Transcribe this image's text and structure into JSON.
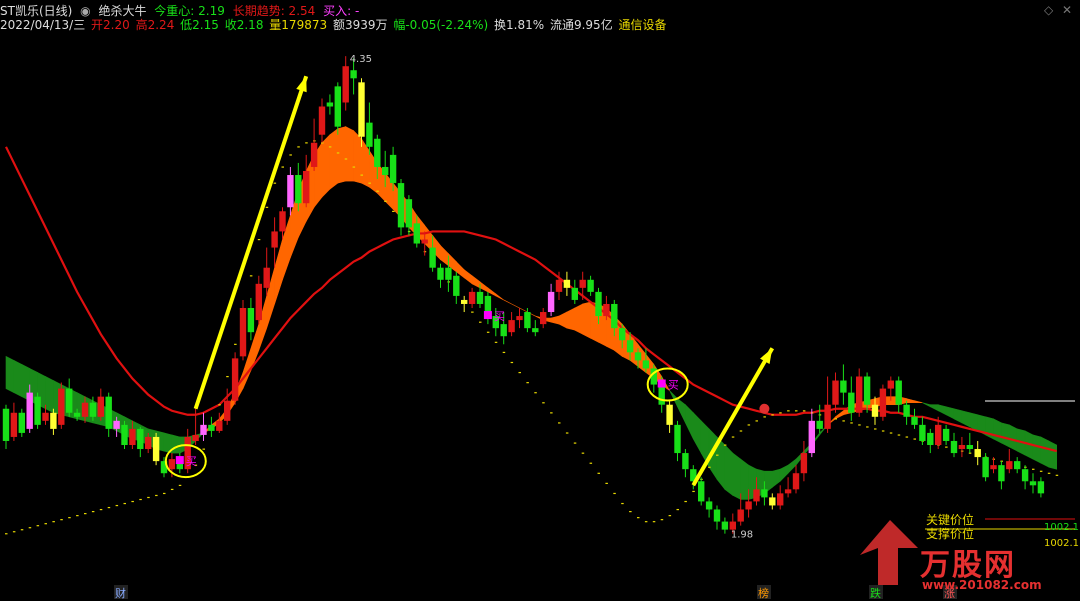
{
  "header": {
    "stock": "ST凯乐(日线)",
    "indicator": "绝杀大牛",
    "center_label": "今重心: 2.19",
    "trend_label": "长期趋势: 2.54",
    "signal_label": "买入: -"
  },
  "quote": {
    "date": "2022/04/13/三",
    "open": "开2.20",
    "high": "高2.24",
    "low": "低2.15",
    "close": "收2.18",
    "volume": "量179873",
    "amount": "额3939万",
    "change": "幅-0.05(-2.24%)",
    "turnover": "换1.81%",
    "float_value": "流通9.95亿",
    "sector": "通信设备"
  },
  "colors": {
    "up": "#e01818",
    "down": "#18e018",
    "ribbon_up": "#ff6600",
    "ribbon_down": "#1a8a1a",
    "trend_line": "#e01010",
    "support_dots": "#e8d800",
    "arrow": "#ffff00",
    "buy_marker": "#ff00ff"
  },
  "chart_data": {
    "type": "candlestick",
    "ylim": [
      1.75,
      4.45
    ],
    "price_high_label": "4.35",
    "price_low_label": "1.98",
    "key_level_label": "关键价位",
    "support_level_label": "支撑价位",
    "key_level_value": "1002.1",
    "support_level_value": "1002.1",
    "buy_label": "买",
    "event_tags": [
      "财",
      "榜",
      "跌",
      "涨"
    ],
    "candles": [
      [
        2.6,
        2.44,
        2.62,
        2.4
      ],
      [
        2.46,
        2.58,
        2.63,
        2.44
      ],
      [
        2.58,
        2.48,
        2.6,
        2.46
      ],
      [
        2.5,
        2.68,
        2.72,
        2.48
      ],
      [
        2.66,
        2.52,
        2.68,
        2.5
      ],
      [
        2.54,
        2.58,
        2.62,
        2.52
      ],
      [
        2.58,
        2.5,
        2.6,
        2.47
      ],
      [
        2.52,
        2.7,
        2.73,
        2.5
      ],
      [
        2.7,
        2.58,
        2.75,
        2.56
      ],
      [
        2.58,
        2.56,
        2.6,
        2.54
      ],
      [
        2.56,
        2.63,
        2.66,
        2.53
      ],
      [
        2.63,
        2.56,
        2.66,
        2.54
      ],
      [
        2.56,
        2.66,
        2.7,
        2.54
      ],
      [
        2.66,
        2.5,
        2.68,
        2.46
      ],
      [
        2.5,
        2.54,
        2.56,
        2.46
      ],
      [
        2.52,
        2.42,
        2.54,
        2.4
      ],
      [
        2.42,
        2.5,
        2.54,
        2.4
      ],
      [
        2.5,
        2.4,
        2.51,
        2.36
      ],
      [
        2.4,
        2.46,
        2.48,
        2.38
      ],
      [
        2.46,
        2.34,
        2.48,
        2.32
      ],
      [
        2.34,
        2.28,
        2.36,
        2.26
      ],
      [
        2.3,
        2.35,
        2.38,
        2.26
      ],
      [
        2.35,
        2.3,
        2.38,
        2.28
      ],
      [
        2.3,
        2.46,
        2.5,
        2.28
      ],
      [
        2.44,
        2.47,
        2.62,
        2.42
      ],
      [
        2.47,
        2.52,
        2.58,
        2.44
      ],
      [
        2.52,
        2.49,
        2.56,
        2.46
      ],
      [
        2.49,
        2.54,
        2.58,
        2.48
      ],
      [
        2.54,
        2.64,
        2.7,
        2.52
      ],
      [
        2.64,
        2.85,
        2.88,
        2.62
      ],
      [
        2.86,
        3.1,
        3.14,
        2.84
      ],
      [
        3.1,
        2.98,
        3.15,
        2.94
      ],
      [
        3.04,
        3.22,
        3.26,
        3.02
      ],
      [
        3.2,
        3.3,
        3.4,
        3.16
      ],
      [
        3.4,
        3.48,
        3.55,
        3.3
      ],
      [
        3.48,
        3.58,
        3.6,
        3.44
      ],
      [
        3.6,
        3.76,
        3.8,
        3.56
      ],
      [
        3.76,
        3.62,
        3.82,
        3.58
      ],
      [
        3.62,
        3.78,
        3.86,
        3.6
      ],
      [
        3.8,
        3.92,
        4.04,
        3.78
      ],
      [
        3.96,
        4.1,
        4.14,
        3.92
      ],
      [
        4.12,
        4.1,
        4.16,
        4.06
      ],
      [
        4.2,
        4.0,
        4.22,
        3.96
      ],
      [
        4.12,
        4.3,
        4.35,
        4.08
      ],
      [
        4.28,
        4.24,
        4.34,
        4.16
      ],
      [
        4.22,
        3.95,
        4.24,
        3.9
      ],
      [
        4.02,
        3.9,
        4.12,
        3.86
      ],
      [
        3.94,
        3.8,
        3.96,
        3.74
      ],
      [
        3.8,
        3.76,
        3.88,
        3.7
      ],
      [
        3.86,
        3.72,
        3.9,
        3.68
      ],
      [
        3.72,
        3.5,
        3.74,
        3.46
      ],
      [
        3.64,
        3.5,
        3.66,
        3.46
      ],
      [
        3.52,
        3.42,
        3.56,
        3.4
      ],
      [
        3.42,
        3.44,
        3.48,
        3.36
      ],
      [
        3.4,
        3.3,
        3.46,
        3.28
      ],
      [
        3.3,
        3.24,
        3.32,
        3.2
      ],
      [
        3.3,
        3.24,
        3.36,
        3.18
      ],
      [
        3.26,
        3.16,
        3.28,
        3.12
      ],
      [
        3.14,
        3.12,
        3.16,
        3.08
      ],
      [
        3.12,
        3.18,
        3.2,
        3.1
      ],
      [
        3.18,
        3.12,
        3.22,
        3.1
      ],
      [
        3.16,
        3.06,
        3.18,
        3.02
      ],
      [
        3.06,
        3.0,
        3.1,
        2.96
      ],
      [
        3.02,
        2.96,
        3.08,
        2.92
      ],
      [
        2.98,
        3.04,
        3.08,
        2.96
      ],
      [
        3.04,
        3.06,
        3.1,
        3.0
      ],
      [
        3.08,
        3.0,
        3.1,
        2.98
      ],
      [
        3.0,
        2.98,
        3.04,
        2.96
      ],
      [
        3.02,
        3.08,
        3.1,
        3.0
      ],
      [
        3.08,
        3.18,
        3.22,
        3.06
      ],
      [
        3.18,
        3.24,
        3.28,
        3.14
      ],
      [
        3.24,
        3.2,
        3.28,
        3.16
      ],
      [
        3.2,
        3.14,
        3.24,
        3.12
      ],
      [
        3.2,
        3.24,
        3.28,
        3.14
      ],
      [
        3.24,
        3.18,
        3.26,
        3.16
      ],
      [
        3.18,
        3.06,
        3.2,
        3.02
      ],
      [
        3.06,
        3.12,
        3.16,
        3.04
      ],
      [
        3.12,
        3.0,
        3.14,
        2.96
      ],
      [
        3.0,
        2.94,
        3.02,
        2.9
      ],
      [
        2.94,
        2.88,
        2.98,
        2.84
      ],
      [
        2.88,
        2.84,
        2.9,
        2.8
      ],
      [
        2.84,
        2.8,
        2.9,
        2.78
      ],
      [
        2.8,
        2.72,
        2.82,
        2.68
      ],
      [
        2.72,
        2.62,
        2.76,
        2.58
      ],
      [
        2.62,
        2.52,
        2.64,
        2.48
      ],
      [
        2.52,
        2.38,
        2.54,
        2.34
      ],
      [
        2.38,
        2.3,
        2.4,
        2.26
      ],
      [
        2.3,
        2.24,
        2.32,
        2.2
      ],
      [
        2.24,
        2.14,
        2.26,
        2.12
      ],
      [
        2.14,
        2.1,
        2.16,
        2.06
      ],
      [
        2.1,
        2.04,
        2.12,
        2.0
      ],
      [
        2.04,
        2.0,
        2.06,
        1.98
      ],
      [
        2.0,
        2.04,
        2.08,
        1.98
      ],
      [
        2.04,
        2.1,
        2.18,
        2.02
      ],
      [
        2.1,
        2.14,
        2.2,
        2.06
      ],
      [
        2.14,
        2.2,
        2.26,
        2.12
      ],
      [
        2.2,
        2.16,
        2.24,
        2.12
      ],
      [
        2.16,
        2.12,
        2.18,
        2.1
      ],
      [
        2.12,
        2.18,
        2.22,
        2.1
      ],
      [
        2.18,
        2.2,
        2.26,
        2.16
      ],
      [
        2.2,
        2.28,
        2.32,
        2.18
      ],
      [
        2.28,
        2.38,
        2.44,
        2.24
      ],
      [
        2.38,
        2.54,
        2.6,
        2.36
      ],
      [
        2.54,
        2.5,
        2.62,
        2.48
      ],
      [
        2.5,
        2.62,
        2.76,
        2.48
      ],
      [
        2.62,
        2.74,
        2.78,
        2.58
      ],
      [
        2.74,
        2.68,
        2.82,
        2.62
      ],
      [
        2.68,
        2.58,
        2.76,
        2.54
      ],
      [
        2.58,
        2.76,
        2.8,
        2.56
      ],
      [
        2.76,
        2.62,
        2.78,
        2.58
      ],
      [
        2.62,
        2.56,
        2.66,
        2.52
      ],
      [
        2.56,
        2.7,
        2.72,
        2.54
      ],
      [
        2.7,
        2.74,
        2.76,
        2.64
      ],
      [
        2.74,
        2.62,
        2.76,
        2.58
      ],
      [
        2.62,
        2.56,
        2.64,
        2.52
      ],
      [
        2.56,
        2.52,
        2.6,
        2.5
      ],
      [
        2.52,
        2.44,
        2.56,
        2.42
      ],
      [
        2.48,
        2.42,
        2.5,
        2.38
      ],
      [
        2.42,
        2.52,
        2.56,
        2.4
      ],
      [
        2.5,
        2.44,
        2.52,
        2.42
      ],
      [
        2.44,
        2.38,
        2.48,
        2.36
      ],
      [
        2.4,
        2.42,
        2.46,
        2.36
      ],
      [
        2.42,
        2.4,
        2.48,
        2.38
      ],
      [
        2.4,
        2.36,
        2.44,
        2.32
      ],
      [
        2.36,
        2.26,
        2.38,
        2.24
      ],
      [
        2.3,
        2.32,
        2.36,
        2.28
      ],
      [
        2.32,
        2.24,
        2.34,
        2.2
      ],
      [
        2.3,
        2.34,
        2.4,
        2.28
      ],
      [
        2.34,
        2.3,
        2.36,
        2.28
      ],
      [
        2.3,
        2.24,
        2.32,
        2.2
      ],
      [
        2.24,
        2.22,
        2.28,
        2.18
      ],
      [
        2.24,
        2.18,
        2.26,
        2.16
      ]
    ],
    "ribbon_fast": [
      2.7,
      2.68,
      2.66,
      2.64,
      2.62,
      2.6,
      2.58,
      2.57,
      2.56,
      2.55,
      2.54,
      2.53,
      2.52,
      2.51,
      2.49,
      2.47,
      2.45,
      2.44,
      2.42,
      2.4,
      2.39,
      2.38,
      2.38,
      2.4,
      2.44,
      2.48,
      2.52,
      2.55,
      2.6,
      2.68,
      2.78,
      2.9,
      3.02,
      3.16,
      3.3,
      3.44,
      3.56,
      3.68,
      3.78,
      3.86,
      3.92,
      3.96,
      3.99,
      4.0,
      3.98,
      3.94,
      3.88,
      3.82,
      3.77,
      3.72,
      3.67,
      3.62,
      3.56,
      3.51,
      3.46,
      3.41,
      3.37,
      3.33,
      3.29,
      3.26,
      3.23,
      3.2,
      3.17,
      3.14,
      3.12,
      3.1,
      3.08,
      3.06,
      3.05,
      3.05,
      3.06,
      3.08,
      3.1,
      3.12,
      3.13,
      3.12,
      3.1,
      3.06,
      3.02,
      2.97,
      2.92,
      2.87,
      2.82,
      2.76,
      2.69,
      2.61,
      2.53,
      2.45,
      2.38,
      2.31,
      2.25,
      2.2,
      2.17,
      2.15,
      2.15,
      2.16,
      2.18,
      2.21,
      2.24,
      2.28,
      2.32,
      2.37,
      2.42,
      2.47,
      2.52,
      2.56,
      2.59,
      2.62,
      2.63,
      2.64,
      2.65,
      2.66,
      2.66,
      2.66,
      2.65,
      2.64,
      2.63,
      2.61,
      2.59,
      2.57,
      2.55,
      2.53,
      2.51,
      2.49,
      2.47,
      2.45,
      2.43,
      2.41,
      2.39,
      2.37,
      2.35,
      2.33,
      2.31,
      2.3
    ],
    "ribbon_slow": [
      2.86,
      2.84,
      2.82,
      2.8,
      2.78,
      2.76,
      2.74,
      2.72,
      2.7,
      2.68,
      2.66,
      2.64,
      2.62,
      2.6,
      2.58,
      2.56,
      2.54,
      2.52,
      2.5,
      2.49,
      2.48,
      2.47,
      2.46,
      2.46,
      2.47,
      2.48,
      2.5,
      2.53,
      2.57,
      2.63,
      2.7,
      2.79,
      2.89,
      3.0,
      3.12,
      3.24,
      3.35,
      3.45,
      3.53,
      3.6,
      3.65,
      3.69,
      3.72,
      3.73,
      3.73,
      3.72,
      3.7,
      3.67,
      3.63,
      3.59,
      3.55,
      3.5,
      3.46,
      3.42,
      3.38,
      3.34,
      3.31,
      3.28,
      3.25,
      3.22,
      3.2,
      3.18,
      3.16,
      3.14,
      3.12,
      3.1,
      3.08,
      3.06,
      3.04,
      3.03,
      3.02,
      3.0,
      2.99,
      2.97,
      2.95,
      2.93,
      2.91,
      2.89,
      2.86,
      2.84,
      2.81,
      2.78,
      2.75,
      2.72,
      2.69,
      2.65,
      2.62,
      2.58,
      2.54,
      2.5,
      2.46,
      2.42,
      2.38,
      2.35,
      2.32,
      2.3,
      2.29,
      2.29,
      2.3,
      2.32,
      2.35,
      2.39,
      2.43,
      2.48,
      2.52,
      2.55,
      2.57,
      2.58,
      2.59,
      2.6,
      2.61,
      2.62,
      2.62,
      2.62,
      2.63,
      2.63,
      2.63,
      2.62,
      2.62,
      2.61,
      2.6,
      2.59,
      2.58,
      2.57,
      2.56,
      2.55,
      2.53,
      2.52,
      2.5,
      2.49,
      2.47,
      2.46,
      2.44,
      2.42
    ],
    "trend_line": [
      3.9,
      3.82,
      3.74,
      3.66,
      3.58,
      3.5,
      3.42,
      3.34,
      3.26,
      3.18,
      3.11,
      3.04,
      2.97,
      2.91,
      2.85,
      2.8,
      2.75,
      2.71,
      2.67,
      2.64,
      2.61,
      2.59,
      2.58,
      2.57,
      2.57,
      2.58,
      2.6,
      2.62,
      2.66,
      2.7,
      2.75,
      2.8,
      2.85,
      2.9,
      2.95,
      3.0,
      3.05,
      3.09,
      3.13,
      3.17,
      3.2,
      3.24,
      3.27,
      3.3,
      3.33,
      3.35,
      3.38,
      3.4,
      3.42,
      3.44,
      3.45,
      3.46,
      3.47,
      3.47,
      3.48,
      3.48,
      3.48,
      3.48,
      3.48,
      3.47,
      3.46,
      3.45,
      3.44,
      3.42,
      3.4,
      3.38,
      3.36,
      3.34,
      3.31,
      3.28,
      3.25,
      3.22,
      3.19,
      3.16,
      3.13,
      3.1,
      3.07,
      3.04,
      3.0,
      2.97,
      2.94,
      2.9,
      2.87,
      2.84,
      2.81,
      2.78,
      2.75,
      2.72,
      2.7,
      2.68,
      2.66,
      2.64,
      2.62,
      2.61,
      2.6,
      2.59,
      2.58,
      2.57,
      2.57,
      2.57,
      2.57,
      2.58,
      2.58,
      2.59,
      2.59,
      2.6,
      2.6,
      2.6,
      2.6,
      2.6,
      2.59,
      2.59,
      2.58,
      2.58,
      2.57,
      2.56,
      2.56,
      2.55,
      2.54,
      2.53,
      2.52,
      2.51,
      2.5,
      2.49,
      2.48,
      2.47,
      2.46,
      2.45,
      2.44,
      2.43,
      2.42,
      2.41,
      2.4,
      2.39
    ],
    "support_dots": [
      1.98,
      1.99,
      2.0,
      2.01,
      2.02,
      2.03,
      2.04,
      2.05,
      2.06,
      2.07,
      2.08,
      2.09,
      2.1,
      2.11,
      2.12,
      2.13,
      2.14,
      2.15,
      2.16,
      2.17,
      2.18,
      2.2,
      2.22,
      2.26,
      2.32,
      2.4,
      2.5,
      2.62,
      2.76,
      2.92,
      3.08,
      3.26,
      3.44,
      3.6,
      3.72,
      3.8,
      3.86,
      3.9,
      3.92,
      3.93,
      3.92,
      3.9,
      3.87,
      3.84,
      3.8,
      3.76,
      3.72,
      3.68,
      3.63,
      3.58,
      3.53,
      3.48,
      3.43,
      3.38,
      3.33,
      3.28,
      3.23,
      3.18,
      3.13,
      3.08,
      3.03,
      2.98,
      2.93,
      2.88,
      2.83,
      2.78,
      2.73,
      2.68,
      2.63,
      2.58,
      2.53,
      2.48,
      2.43,
      2.38,
      2.33,
      2.28,
      2.23,
      2.18,
      2.13,
      2.09,
      2.06,
      2.04,
      2.04,
      2.05,
      2.07,
      2.1,
      2.14,
      2.19,
      2.25,
      2.31,
      2.37,
      2.42,
      2.46,
      2.49,
      2.52,
      2.54,
      2.56,
      2.57,
      2.58,
      2.59,
      2.59,
      2.59,
      2.58,
      2.57,
      2.56,
      2.55,
      2.54,
      2.53,
      2.52,
      2.51,
      2.5,
      2.49,
      2.48,
      2.47,
      2.46,
      2.45,
      2.44,
      2.43,
      2.42,
      2.41,
      2.4,
      2.39,
      2.38,
      2.37,
      2.36,
      2.35,
      2.34,
      2.33,
      2.32,
      2.31,
      2.3,
      2.29,
      2.28,
      2.27
    ],
    "buy_signals": [
      22,
      83
    ],
    "arrows": [
      [
        24,
        2.6,
        38,
        4.25
      ],
      [
        87,
        2.22,
        97,
        2.9
      ]
    ]
  },
  "watermark": {
    "brand": "万股网",
    "url": "www.201082.com"
  }
}
